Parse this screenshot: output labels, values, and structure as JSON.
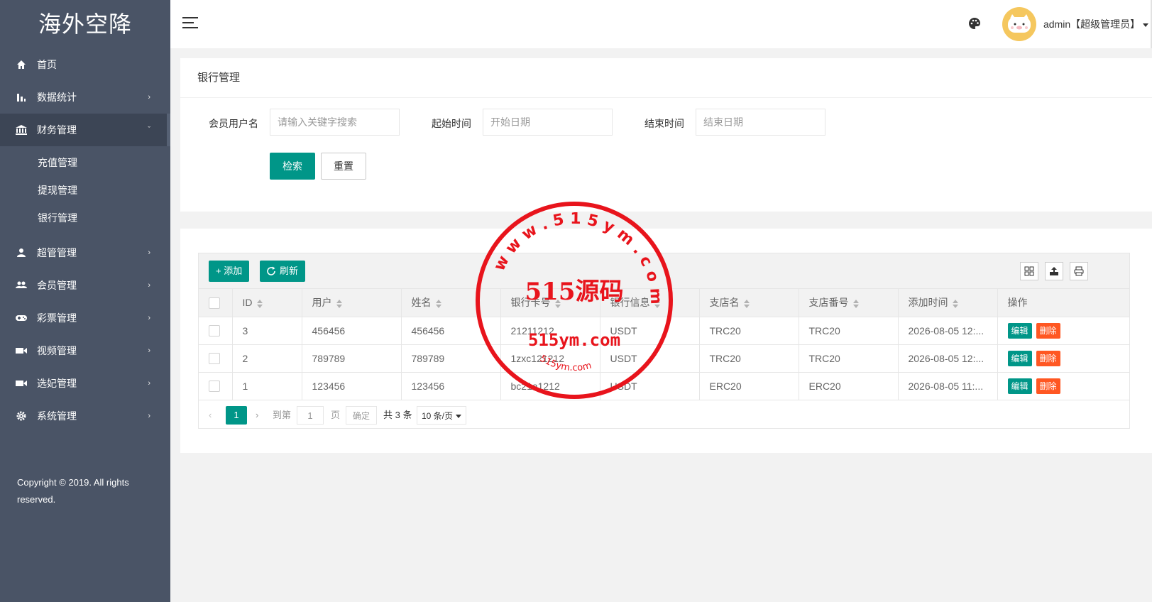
{
  "app": {
    "title": "海外空降"
  },
  "sidebar": {
    "items": [
      {
        "label": "首页",
        "icon": "home-icon",
        "arrow": ""
      },
      {
        "label": "数据统计",
        "icon": "bar-chart-icon",
        "arrow": "›"
      },
      {
        "label": "财务管理",
        "icon": "bank-icon",
        "arrow": "ˇ"
      },
      {
        "label": "超管管理",
        "icon": "user-icon",
        "arrow": "›"
      },
      {
        "label": "会员管理",
        "icon": "users-icon",
        "arrow": "›"
      },
      {
        "label": "彩票管理",
        "icon": "gamepad-icon",
        "arrow": "›"
      },
      {
        "label": "视频管理",
        "icon": "video-icon",
        "arrow": "›"
      },
      {
        "label": "选妃管理",
        "icon": "video-camera-icon",
        "arrow": "›"
      },
      {
        "label": "系统管理",
        "icon": "gear-icon",
        "arrow": "›"
      }
    ],
    "sub_items": [
      {
        "label": "充值管理"
      },
      {
        "label": "提现管理"
      },
      {
        "label": "银行管理"
      }
    ],
    "copyright": "Copyright © 2019. All rights reserved."
  },
  "header": {
    "user": "admin【超级管理员】"
  },
  "search_card": {
    "title": "银行管理",
    "fields": [
      {
        "label": "会员用户名",
        "placeholder": "请输入关键字搜索"
      },
      {
        "label": "起始时间",
        "placeholder": "开始日期"
      },
      {
        "label": "结束时间",
        "placeholder": "结束日期"
      }
    ],
    "search_label": "检索",
    "reset_label": "重置"
  },
  "table": {
    "add_label": "+ 添加",
    "refresh_label": "刷新",
    "columns": [
      "ID",
      "用户",
      "姓名",
      "银行卡号",
      "银行信息",
      "支店名",
      "支店番号",
      "添加时间",
      "操作"
    ],
    "rows": [
      {
        "id": "3",
        "user": "456456",
        "name": "456456",
        "card": "21211212",
        "bank": "USDT",
        "branch": "TRC20",
        "branch_no": "TRC20",
        "time": "2026-08-05 12:..."
      },
      {
        "id": "2",
        "user": "789789",
        "name": "789789",
        "card": "1zxc121212",
        "bank": "USDT",
        "branch": "TRC20",
        "branch_no": "TRC20",
        "time": "2026-08-05 12:..."
      },
      {
        "id": "1",
        "user": "123456",
        "name": "123456",
        "card": "bc21a1212",
        "bank": "USDT",
        "branch": "ERC20",
        "branch_no": "ERC20",
        "time": "2026-08-05 11:..."
      }
    ],
    "edit_label": "编辑",
    "delete_label": "删除"
  },
  "pager": {
    "current_page": "1",
    "goto_label": "到第",
    "goto_value": "1",
    "page_unit": "页",
    "confirm_label": "确定",
    "total_label": "共 3 条",
    "page_size": "10 条/页"
  },
  "watermark": {
    "ring_text": "w w w . 5 1 5 y m . c o m",
    "main_text": "515源码",
    "url_text": "515ym.com",
    "bottom_text": "515ym.com",
    "color": "#e8141c"
  },
  "colors": {
    "sidebar": "#4a5466",
    "primary": "#009688",
    "danger": "#ff5722"
  }
}
